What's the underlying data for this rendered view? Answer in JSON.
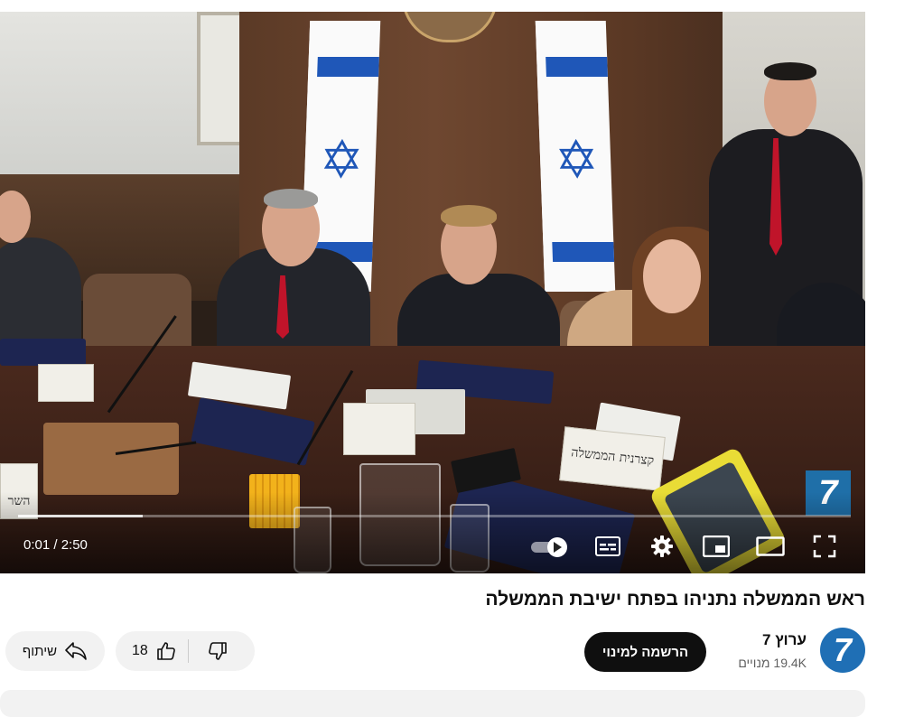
{
  "player": {
    "time_display": "0:01 / 2:50",
    "progress_fraction": 0.15,
    "controls": [
      "autoplay-toggle",
      "subtitles-icon",
      "settings-icon",
      "miniplayer-icon",
      "theater-mode-icon",
      "fullscreen-icon"
    ],
    "watermark": "7",
    "nameplates": [
      "השר",
      "קצרנית הממשלה"
    ]
  },
  "video": {
    "title": "ראש הממשלה נתניהו בפתח ישיבת הממשלה"
  },
  "channel": {
    "avatar_glyph": "7",
    "name": "ערוץ 7",
    "subscribers": "19.4K מנויים",
    "subscribe_label": "הרשמה למינוי"
  },
  "actions": {
    "like_count": "18",
    "share_label": "שיתוף"
  },
  "colors": {
    "subscribe_bg": "#0f0f0f",
    "channel_brand": "#1f6fb5",
    "pill_bg": "#f2f2f2",
    "flag_blue": "#1f57b8"
  }
}
